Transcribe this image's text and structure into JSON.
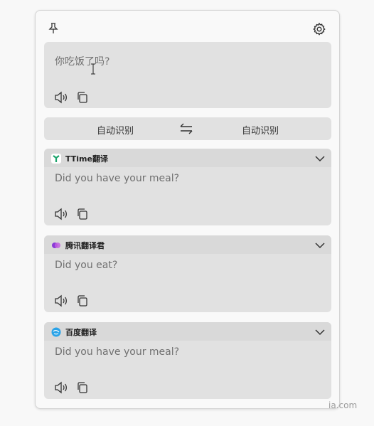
{
  "source": {
    "text": "你吃饭了吗?"
  },
  "languages": {
    "from": "自动识别",
    "to": "自动识别"
  },
  "results": [
    {
      "service": "TTime翻译",
      "text": "Did you have your meal?",
      "icon": "ttime-logo-icon"
    },
    {
      "service": "腾讯翻译君",
      "text": "Did you eat?",
      "icon": "tencent-logo-icon"
    },
    {
      "service": "百度翻译",
      "text": "Did you have your meal?",
      "icon": "baidu-logo-icon"
    }
  ],
  "watermark": "ia.com",
  "colors": {
    "panel": "#e1e1e1",
    "header": "#d9d9d9",
    "text": "#707070"
  }
}
